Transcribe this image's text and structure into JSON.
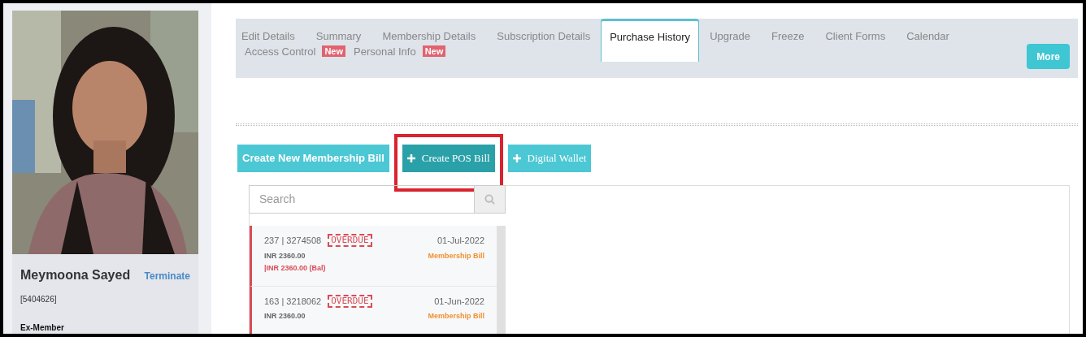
{
  "profile": {
    "name": "Meymoona Sayed",
    "action": "Terminate",
    "member_id": "[5404626]",
    "status": "Ex-Member"
  },
  "tabs": [
    {
      "label": "Edit Details",
      "selected": false
    },
    {
      "label": "Summary",
      "selected": false
    },
    {
      "label": "Membership Details",
      "selected": false
    },
    {
      "label": "Subscription Details",
      "selected": false
    },
    {
      "label": "Purchase History",
      "selected": true
    },
    {
      "label": "Upgrade",
      "selected": false
    },
    {
      "label": "Freeze",
      "selected": false
    },
    {
      "label": "Client Forms",
      "selected": false
    },
    {
      "label": "Calendar",
      "selected": false
    },
    {
      "label": "Access Control",
      "selected": false,
      "badge": "New"
    },
    {
      "label": "Personal Info",
      "selected": false,
      "badge": "New"
    }
  ],
  "more_button": "More",
  "actions": [
    {
      "label": "Create New Membership Bill",
      "icon": false,
      "highlighted": false
    },
    {
      "label": "Create POS Bill",
      "icon": true,
      "highlighted": true
    },
    {
      "label": "Digital Wallet",
      "icon": true,
      "highlighted": false
    }
  ],
  "search": {
    "placeholder": "Search"
  },
  "bills": [
    {
      "number": "237 | 3274508",
      "stamp": "OVERDUE",
      "date": "01-Jul-2022",
      "amount": "INR 2360.00",
      "type": "Membership Bill",
      "balance": "|INR 2360.00 (Bal)"
    },
    {
      "number": "163 | 3218062",
      "stamp": "OVERDUE",
      "date": "01-Jun-2022",
      "amount": "INR 2360.00",
      "type": "Membership Bill"
    }
  ]
}
